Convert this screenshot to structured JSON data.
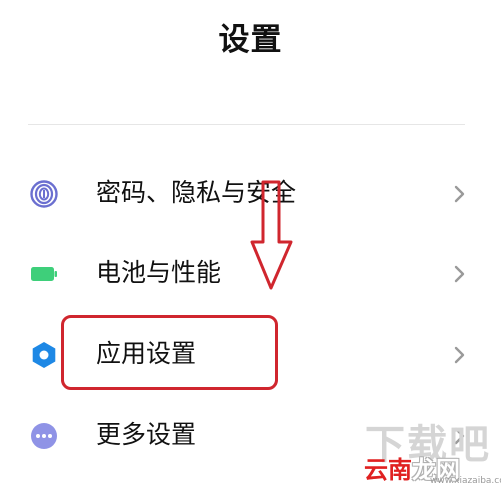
{
  "header": {
    "title": "设置"
  },
  "settings": {
    "items": [
      {
        "label": "密码、隐私与安全",
        "icon": "fingerprint-icon",
        "icon_color": "#6b6fd0"
      },
      {
        "label": "电池与性能",
        "icon": "battery-icon",
        "icon_color": "#3ecf7a"
      },
      {
        "label": "应用设置",
        "icon": "gear-icon",
        "icon_color": "#1e88e5"
      },
      {
        "label": "更多设置",
        "icon": "more-dots-icon",
        "icon_color": "#7b7fe0"
      }
    ],
    "chevron_icon": "chevron-right-icon"
  },
  "annotation": {
    "highlight_color": "#d0262e"
  },
  "watermark": {
    "big_text": "下载吧",
    "brand_part1": "云南",
    "brand_part2": "龙网",
    "url": "www.xiazaiba.com"
  }
}
